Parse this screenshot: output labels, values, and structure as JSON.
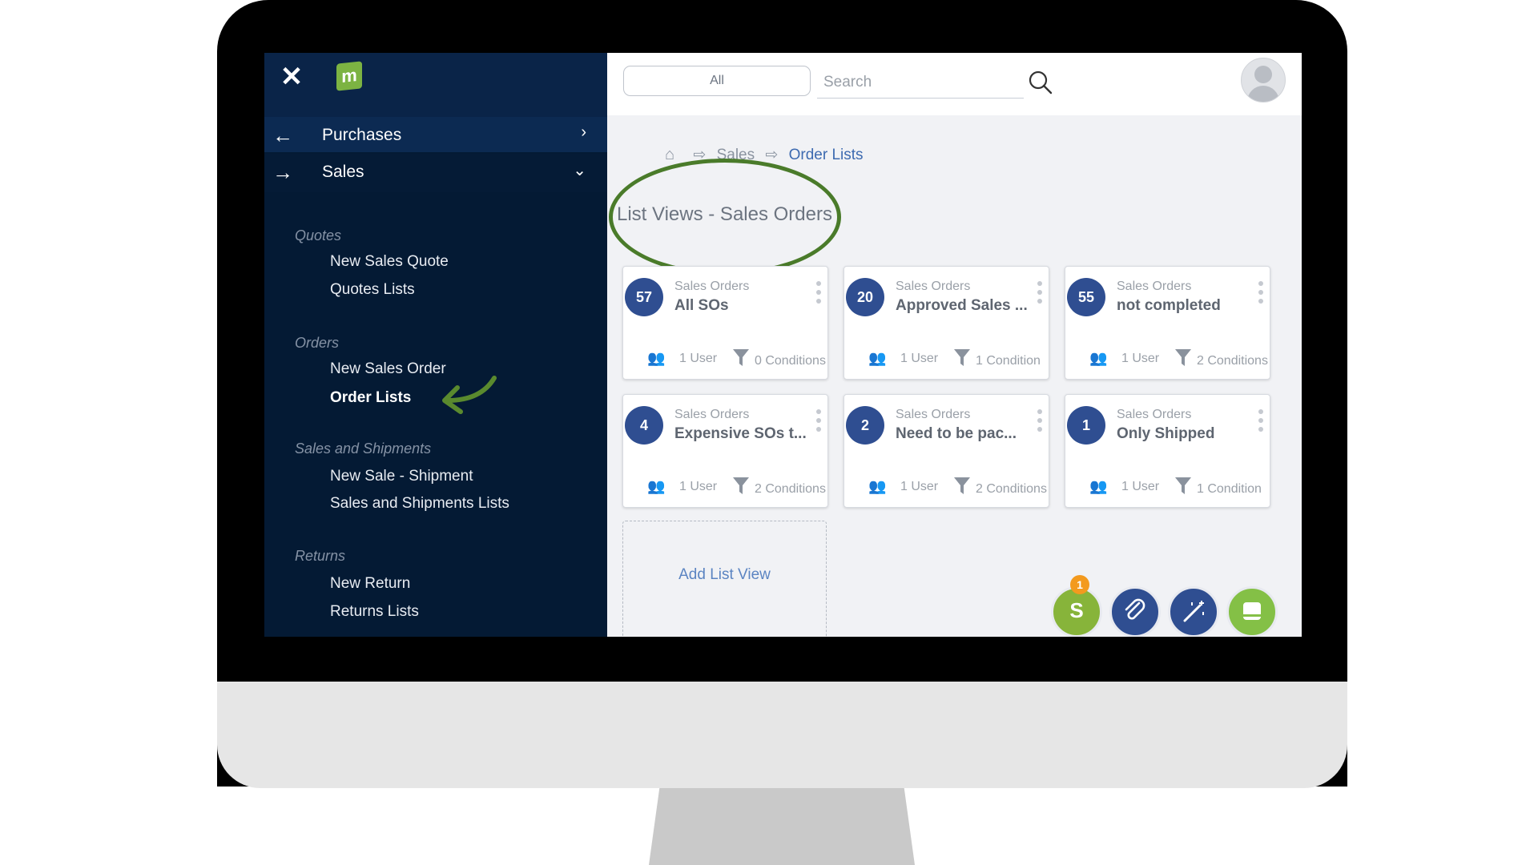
{
  "sidebar": {
    "nav_purchases": "Purchases",
    "nav_sales": "Sales",
    "sections": {
      "quotes": "Quotes",
      "orders": "Orders",
      "sales_shipments": "Sales and Shipments",
      "returns": "Returns"
    },
    "items": {
      "new_sales_quote": "New Sales Quote",
      "quotes_lists": "Quotes Lists",
      "new_sales_order": "New Sales Order",
      "order_lists": "Order Lists",
      "new_sale_shipment": "New Sale - Shipment",
      "sales_shipments_lists": "Sales and Shipments Lists",
      "new_return": "New Return",
      "returns_lists": "Returns Lists"
    }
  },
  "topbar": {
    "scope": "All",
    "search_placeholder": "Search"
  },
  "breadcrumb": {
    "parent": "Sales",
    "current": "Order Lists"
  },
  "page_title": "List Views - Sales Orders",
  "cards": [
    {
      "count": "57",
      "category": "Sales Orders",
      "name": "All SOs",
      "users": "1 User",
      "conditions": "0 Conditions"
    },
    {
      "count": "20",
      "category": "Sales Orders",
      "name": "Approved Sales ...",
      "users": "1 User",
      "conditions": "1 Condition"
    },
    {
      "count": "55",
      "category": "Sales Orders",
      "name": "not completed",
      "users": "1 User",
      "conditions": "2 Conditions"
    },
    {
      "count": "4",
      "category": "Sales Orders",
      "name": "Expensive SOs t...",
      "users": "1 User",
      "conditions": "2 Conditions"
    },
    {
      "count": "2",
      "category": "Sales Orders",
      "name": "Need to be pac...",
      "users": "1 User",
      "conditions": "2 Conditions"
    },
    {
      "count": "1",
      "category": "Sales Orders",
      "name": "Only Shipped",
      "users": "1 User",
      "conditions": "1 Condition"
    }
  ],
  "add_list_view": "Add List View",
  "notification_count": "1",
  "colors": {
    "sidebar_bg": "#041a34",
    "badge": "#2f4e91",
    "annotation_green": "#4a7b2a",
    "link_blue": "#3d6ab0"
  },
  "icons": [
    "close-icon",
    "logo-icon",
    "back-arrow-icon",
    "forward-arrow-icon",
    "chevron-right-icon",
    "chevron-down-icon",
    "search-icon",
    "avatar-icon",
    "users-icon",
    "filter-icon",
    "kebab-icon",
    "shopify-icon",
    "attachment-icon",
    "magic-wand-icon",
    "chat-icon"
  ]
}
